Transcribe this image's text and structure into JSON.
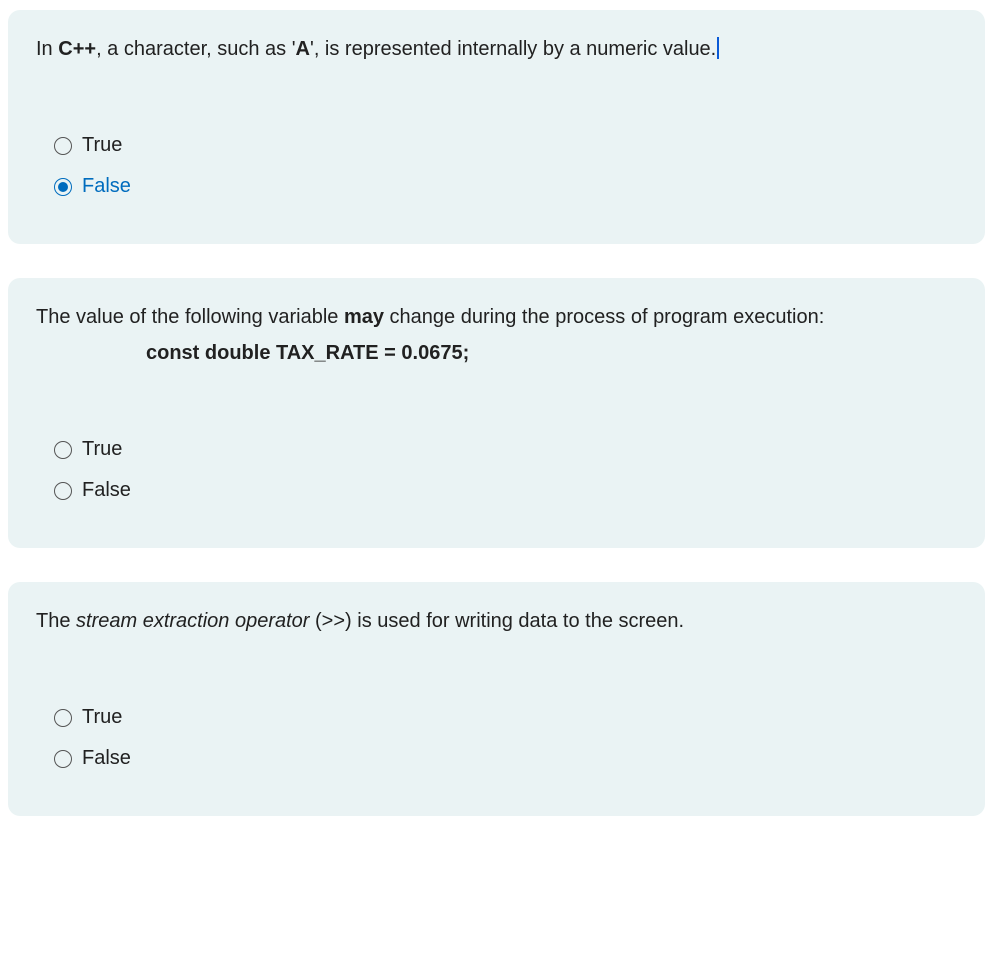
{
  "questions": [
    {
      "prompt_parts": [
        {
          "text": "In ",
          "style": ""
        },
        {
          "text": "C++",
          "style": "bold"
        },
        {
          "text": ", a character, such as '",
          "style": ""
        },
        {
          "text": "A",
          "style": "bold"
        },
        {
          "text": "', is represented internally by a numeric value.",
          "style": ""
        }
      ],
      "show_cursor": true,
      "code_line": "",
      "options": [
        {
          "label": "True",
          "selected": false
        },
        {
          "label": "False",
          "selected": true
        }
      ]
    },
    {
      "prompt_parts": [
        {
          "text": "The value of the following variable ",
          "style": ""
        },
        {
          "text": "may",
          "style": "bold"
        },
        {
          "text": " change during the process of program execution:",
          "style": ""
        }
      ],
      "show_cursor": false,
      "code_line": "const double TAX_RATE = 0.0675;",
      "options": [
        {
          "label": "True",
          "selected": false
        },
        {
          "label": "False",
          "selected": false
        }
      ]
    },
    {
      "prompt_parts": [
        {
          "text": "The ",
          "style": ""
        },
        {
          "text": "stream extraction operator",
          "style": "italic"
        },
        {
          "text": " (>>) is used for writing data to the screen.",
          "style": ""
        }
      ],
      "show_cursor": false,
      "code_line": "",
      "options": [
        {
          "label": "True",
          "selected": false
        },
        {
          "label": "False",
          "selected": false
        }
      ]
    }
  ]
}
